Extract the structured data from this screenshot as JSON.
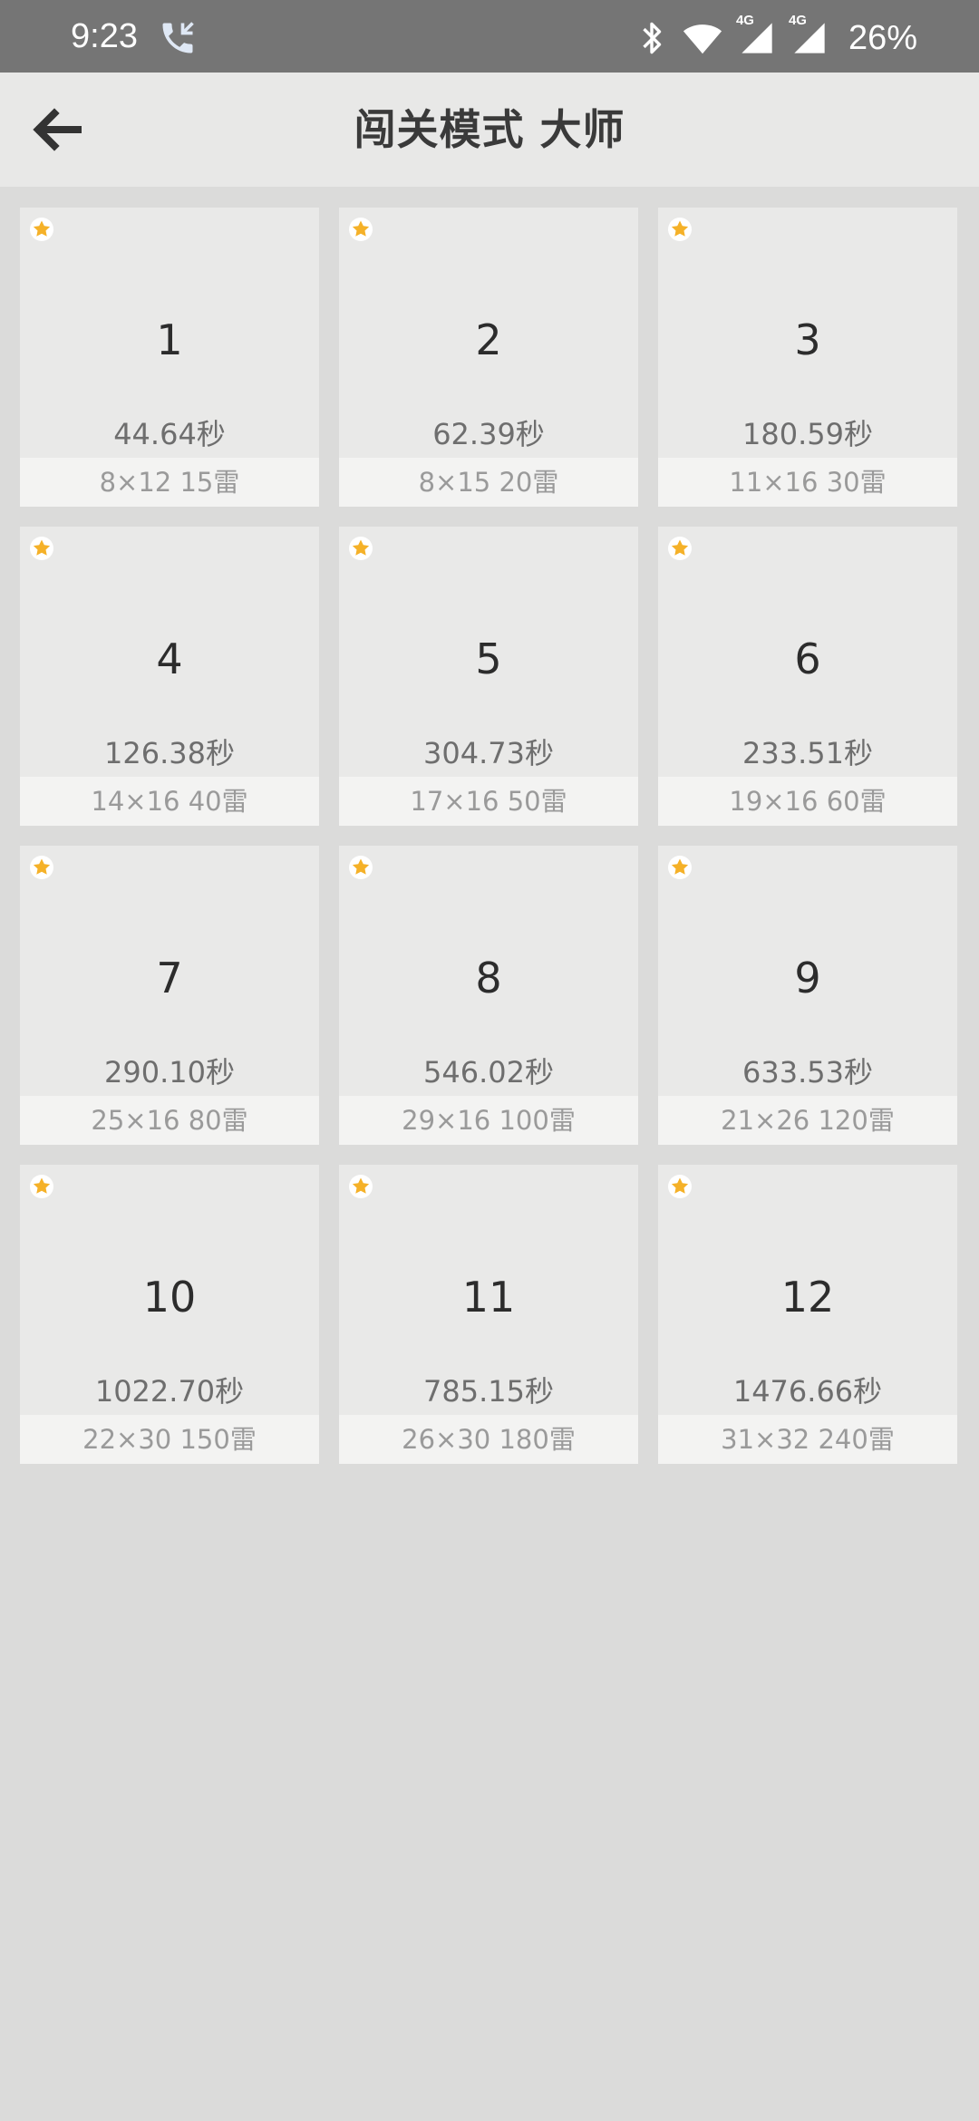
{
  "status_bar": {
    "time": "9:23",
    "battery": "26%",
    "network_label_1": "4G",
    "network_label_2": "4G",
    "icons": [
      "call-icon",
      "bluetooth-icon",
      "wifi-icon",
      "signal-4g-icon",
      "signal-4g-icon"
    ]
  },
  "header": {
    "title": "闯关模式 大师",
    "back_icon": "arrow-left-icon"
  },
  "colors": {
    "star": "#f5b128",
    "status_bar_bg": "#757575",
    "header_bg": "#e8e8e7",
    "page_bg": "#dbdbda",
    "card_bg": "#e9e9e8",
    "card_footer_bg": "#f3f3f2"
  },
  "levels": [
    {
      "number": "1",
      "time": "44.64秒",
      "info": "8×12  15雷"
    },
    {
      "number": "2",
      "time": "62.39秒",
      "info": "8×15  20雷"
    },
    {
      "number": "3",
      "time": "180.59秒",
      "info": "11×16  30雷"
    },
    {
      "number": "4",
      "time": "126.38秒",
      "info": "14×16  40雷"
    },
    {
      "number": "5",
      "time": "304.73秒",
      "info": "17×16  50雷"
    },
    {
      "number": "6",
      "time": "233.51秒",
      "info": "19×16  60雷"
    },
    {
      "number": "7",
      "time": "290.10秒",
      "info": "25×16  80雷"
    },
    {
      "number": "8",
      "time": "546.02秒",
      "info": "29×16  100雷"
    },
    {
      "number": "9",
      "time": "633.53秒",
      "info": "21×26  120雷"
    },
    {
      "number": "10",
      "time": "1022.70秒",
      "info": "22×30  150雷"
    },
    {
      "number": "11",
      "time": "785.15秒",
      "info": "26×30  180雷"
    },
    {
      "number": "12",
      "time": "1476.66秒",
      "info": "31×32  240雷"
    }
  ]
}
